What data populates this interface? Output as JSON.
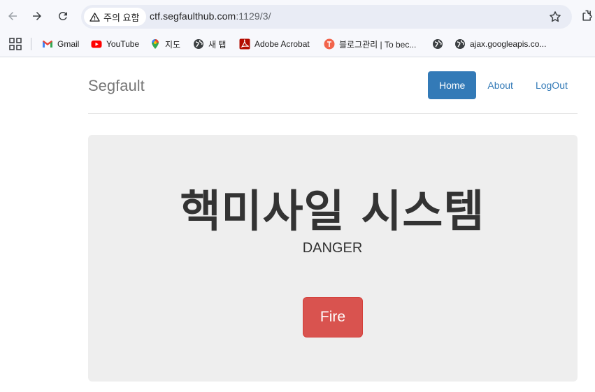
{
  "browser": {
    "security_label": "주의 요함",
    "url_host": "ctf.segfaulthub.com",
    "url_path": ":1129/3/",
    "bookmarks": [
      {
        "label": "Gmail",
        "icon": "gmail-icon"
      },
      {
        "label": "YouTube",
        "icon": "youtube-icon"
      },
      {
        "label": "지도",
        "icon": "maps-icon"
      },
      {
        "label": "새 탭",
        "icon": "globe-icon"
      },
      {
        "label": "Adobe Acrobat",
        "icon": "acrobat-icon"
      },
      {
        "label": "블로그관리 | To bec...",
        "icon": "blog-icon"
      },
      {
        "label": "",
        "icon": "globe-icon"
      },
      {
        "label": "ajax.googleapis.co...",
        "icon": "globe-icon"
      }
    ]
  },
  "site": {
    "brand": "Segfault",
    "nav": [
      "Home",
      "About",
      "LogOut"
    ],
    "active_nav": "Home"
  },
  "jumbotron": {
    "title": "핵미사일 시스템",
    "subtitle": "DANGER",
    "button_label": "Fire"
  },
  "colors": {
    "primary": "#337ab7",
    "danger": "#d9534f",
    "jumbotron_bg": "#eeeeee"
  }
}
